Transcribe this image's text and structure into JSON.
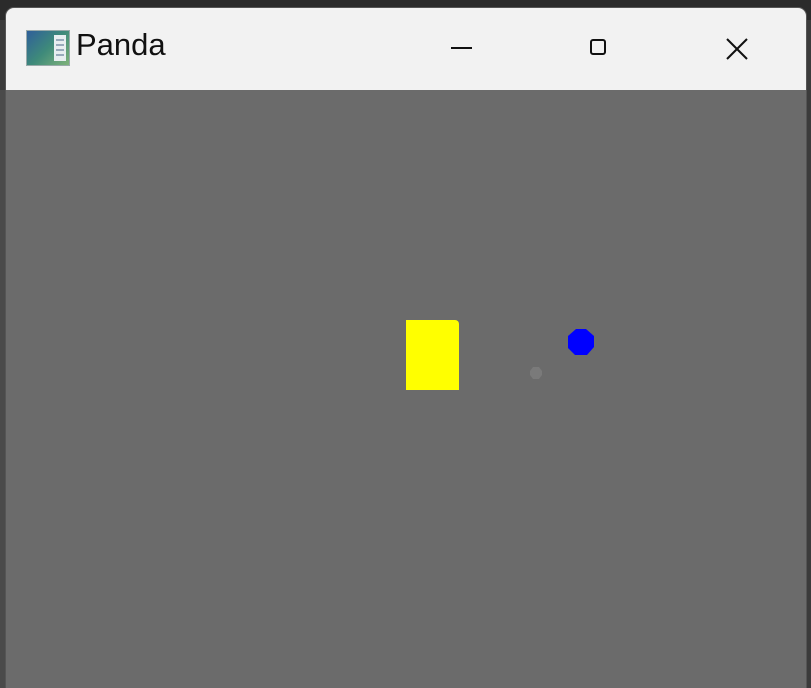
{
  "window": {
    "title": "Panda",
    "icon": "panda-app-icon",
    "controls": {
      "minimize": "minimize-icon",
      "maximize": "maximize-icon",
      "close": "close-icon"
    }
  },
  "scene": {
    "background_color": "#6b6b6b",
    "objects": [
      {
        "name": "yellow-box",
        "color": "#ffff00"
      },
      {
        "name": "blue-sphere",
        "color": "#0000ff"
      },
      {
        "name": "grey-sphere",
        "color": "#7a7a7a"
      }
    ]
  }
}
